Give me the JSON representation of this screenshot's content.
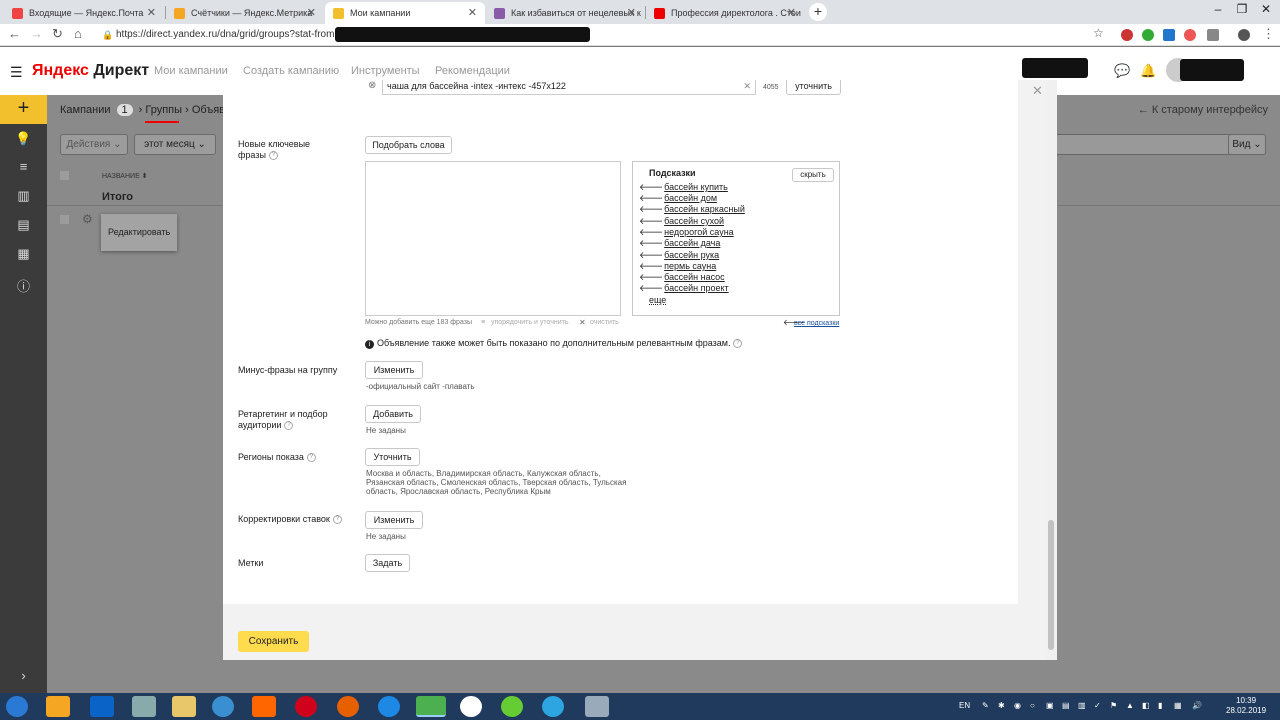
{
  "browser": {
    "tabs": [
      {
        "label": "Входящие — Яндекс.Почта",
        "color": "#e44"
      },
      {
        "label": "Счётчики — Яндекс.Метрика",
        "color": "#f5a623"
      },
      {
        "label": "Мои кампании",
        "color": "#f2c02c"
      },
      {
        "label": "Как избавиться от нецелевых к",
        "color": "#8a5ca8"
      },
      {
        "label": "Профессия директолога . Стои",
        "color": "#e00"
      }
    ],
    "new_tab": "+",
    "url": "https://direct.yandex.ru/dna/grid/groups?stat-from=..."
  },
  "header": {
    "logo_ya": "Яндекс",
    "logo_product": "Директ",
    "nav": [
      "Мои кампании",
      "Создать кампанию",
      "Инструменты",
      "Рекомендации"
    ]
  },
  "sidebar": {
    "add": "+",
    "icons": [
      "lightbulb-icon",
      "list-icon",
      "chart-icon",
      "stack-icon",
      "grid-icon",
      "info-icon"
    ]
  },
  "background_page": {
    "crumb_campaigns": "Кампании",
    "crumb_count": "1",
    "crumb_groups": "Группы",
    "crumb_ads": "Объяв",
    "old_ui": "← К старому интерфейсу",
    "actions": "Действия ⌄",
    "period": "этот месяц ⌄",
    "view": "Вид ⌄",
    "col_name": "НАЗВАНИЕ ⬍",
    "total": "Итого",
    "edit_popup": "Редактировать"
  },
  "modal": {
    "phrase_value": "чаша для бассейна -intex -интекс -457x122",
    "phrase_count": "4055",
    "refine_btn": "уточнить",
    "new_keywords_label": "Новые ключевые фразы",
    "pick_words_btn": "Подобрать слова",
    "can_add_more": "Можно добавить еще 183 фразы",
    "sort_and_refine": "упорядочить и уточнить",
    "clear": "очистить",
    "hints": {
      "title": "Подсказки",
      "hide": "скрыть",
      "items": [
        "бассейн купить",
        "бассейн дом",
        "бассейн каркасный",
        "бассейн сухой",
        "недорогой сауна",
        "бассейн дача",
        "бассейн рука",
        "пермь сауна",
        "бассейн насос",
        "бассейн проект"
      ],
      "more": "еще",
      "all_hints": "все подсказки"
    },
    "relevant_note": "Объявление также может быть показано по дополнительным релевантным фразам.",
    "minus_label": "Минус-фразы на группу",
    "minus_btn": "Изменить",
    "minus_value": "-официальный сайт -плавать",
    "retarget_label": "Ретаргетинг и подбор аудитории",
    "retarget_btn": "Добавить",
    "retarget_value": "Не заданы",
    "regions_label": "Регионы показа",
    "regions_btn": "Уточнить",
    "regions_value": "Москва и область, Владимирская область, Калужская область, Рязанская область, Смоленская область, Тверская область, Тульская область, Ярославская область, Республика Крым",
    "bids_label": "Корректировки ставок",
    "bids_btn": "Изменить",
    "bids_value": "Не заданы",
    "tags_label": "Метки",
    "tags_btn": "Задать",
    "save_btn": "Сохранить"
  },
  "taskbar": {
    "lang": "EN",
    "time": "10:39",
    "date": "28.02.2019"
  }
}
